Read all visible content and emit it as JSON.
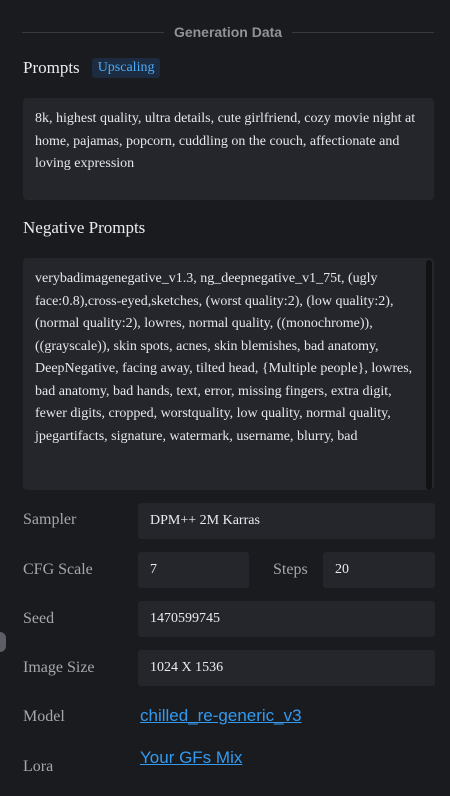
{
  "section_title": "Generation Data",
  "prompts": {
    "label": "Prompts",
    "badge": "Upscaling",
    "text": "8k, highest quality, ultra details, cute girlfriend, cozy movie night at home, pajamas, popcorn, cuddling on the couch, affectionate and loving expression"
  },
  "negative": {
    "label": "Negative Prompts",
    "text": "verybadimagenegative_v1.3, ng_deepnegative_v1_75t, (ugly face:0.8),cross-eyed,sketches, (worst quality:2), (low quality:2), (normal quality:2), lowres, normal quality, ((monochrome)), ((grayscale)), skin spots, acnes, skin blemishes, bad anatomy, DeepNegative, facing away, tilted head, {Multiple people}, lowres, bad anatomy, bad hands, text, error, missing fingers, extra digit, fewer digits, cropped, worstquality, low quality, normal quality, jpegartifacts, signature, watermark, username, blurry, bad"
  },
  "params": {
    "sampler_label": "Sampler",
    "sampler_value": "DPM++ 2M Karras",
    "cfg_label": "CFG Scale",
    "cfg_value": "7",
    "steps_label": "Steps",
    "steps_value": "20",
    "seed_label": "Seed",
    "seed_value": "1470599745",
    "size_label": "Image Size",
    "size_value": "1024 X 1536",
    "model_label": "Model",
    "model_value": "chilled_re-generic_v3",
    "lora_label": "Lora",
    "lora_value": "Your GFs Mix"
  }
}
